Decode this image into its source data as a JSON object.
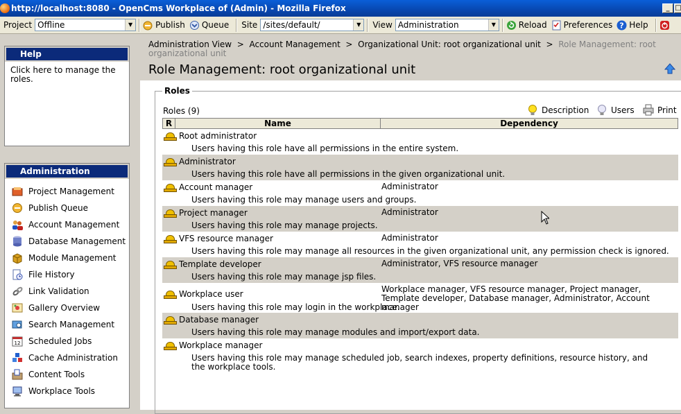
{
  "window": {
    "title": "http://localhost:8080 - OpenCms Workplace of (Admin) - Mozilla Firefox"
  },
  "toolbar": {
    "project_label": "Project",
    "project_value": "Offline",
    "publish_label": "Publish",
    "queue_label": "Queue",
    "site_label": "Site",
    "site_value": "/sites/default/",
    "view_label": "View",
    "view_value": "Administration",
    "reload_label": "Reload",
    "preferences_label": "Preferences",
    "help_label": "Help"
  },
  "help": {
    "title": "Help",
    "text": "Click here to manage the roles."
  },
  "admin": {
    "title": "Administration",
    "items": [
      {
        "label": "Project Management",
        "icon": "project-icon"
      },
      {
        "label": "Publish Queue",
        "icon": "publish-queue-icon"
      },
      {
        "label": "Account Management",
        "icon": "accounts-icon"
      },
      {
        "label": "Database Management",
        "icon": "database-icon"
      },
      {
        "label": "Module Management",
        "icon": "module-icon"
      },
      {
        "label": "File History",
        "icon": "file-history-icon"
      },
      {
        "label": "Link Validation",
        "icon": "link-icon"
      },
      {
        "label": "Gallery Overview",
        "icon": "gallery-icon"
      },
      {
        "label": "Search Management",
        "icon": "search-icon"
      },
      {
        "label": "Scheduled Jobs",
        "icon": "calendar-icon"
      },
      {
        "label": "Cache Administration",
        "icon": "cache-icon"
      },
      {
        "label": "Content Tools",
        "icon": "content-tools-icon"
      },
      {
        "label": "Workplace Tools",
        "icon": "workplace-tools-icon"
      }
    ]
  },
  "main": {
    "breadcrumb": {
      "item1": "Administration View",
      "item2": "Account Management",
      "item3": "Organizational Unit: root organizational unit",
      "current": "Role Management: root organizational unit",
      "sep": ">"
    },
    "page_title": "Role Management: root organizational unit",
    "roles": {
      "legend": "Roles",
      "count": "Roles (9)",
      "actions": {
        "description": "Description",
        "users": "Users",
        "print": "Print"
      },
      "columns": {
        "r": "R",
        "name": "Name",
        "dependency": "Dependency"
      },
      "rows": [
        {
          "name": "Root administrator",
          "dependency": "",
          "description": "Users having this role have all permissions in the entire system."
        },
        {
          "name": "Administrator",
          "dependency": "",
          "description": "Users having this role have all permissions in the given organizational unit."
        },
        {
          "name": "Account manager",
          "dependency": "Administrator",
          "description": "Users having this role may manage users and groups."
        },
        {
          "name": "Project manager",
          "dependency": "Administrator",
          "description": "Users having this role may manage projects."
        },
        {
          "name": "VFS resource manager",
          "dependency": "Administrator",
          "description": "Users having this role may manage all resources in the given organizational unit, any permission check is ignored."
        },
        {
          "name": "Template developer",
          "dependency": "Administrator, VFS resource manager",
          "description": "Users having this role may manage jsp files."
        },
        {
          "name": "Workplace user",
          "dependency": "Workplace manager, VFS resource manager, Project manager, Template developer, Database manager, Administrator, Account manager",
          "description": "Users having this role may login in the workplace."
        },
        {
          "name": "Database manager",
          "dependency": "",
          "description": "Users having this role may manage modules and import/export data."
        },
        {
          "name": "Workplace manager",
          "dependency": "",
          "description": "Users having this role may manage scheduled job, search indexes, property definitions, resource history, and the workplace tools."
        }
      ]
    }
  }
}
